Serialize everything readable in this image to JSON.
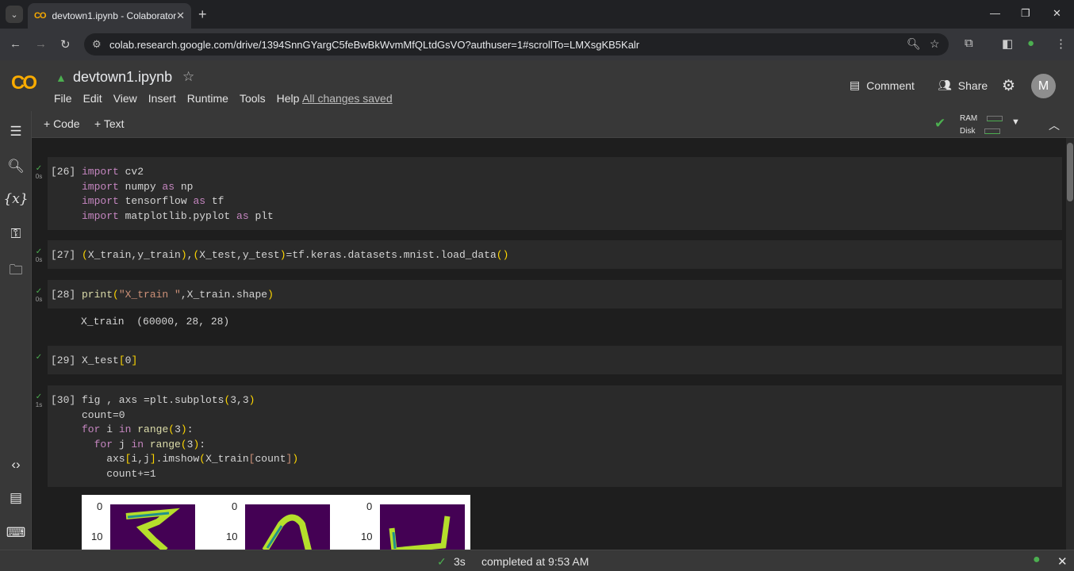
{
  "browser": {
    "tab_title": "devtown1.ipynb - Colaboratory",
    "tab_favicon": "CO",
    "url": "colab.research.google.com/drive/1394SnnGYargC5feBwBkWvmMfQLtdGsVO?authuser=1#scrollTo=LMXsgKB5Kalr",
    "profile_color": "#4caf50"
  },
  "header": {
    "logo": "CO",
    "title": "devtown1.ipynb",
    "menu": [
      "File",
      "Edit",
      "View",
      "Insert",
      "Runtime",
      "Tools",
      "Help"
    ],
    "saved_status": "All changes saved",
    "comment_label": "Comment",
    "share_label": "Share",
    "avatar_letter": "M"
  },
  "toolbar": {
    "code_label": "+ Code",
    "text_label": "+ Text",
    "ram_label": "RAM",
    "disk_label": "Disk"
  },
  "cells": [
    {
      "num": "[26]",
      "time": "0s",
      "code": "import cv2\nimport numpy as np\nimport tensorflow as tf\nimport matplotlib.pyplot as plt"
    },
    {
      "num": "[27]",
      "time": "0s",
      "code": "(X_train,y_train),(X_test,y_test)=tf.keras.datasets.mnist.load_data()"
    },
    {
      "num": "[28]",
      "time": "0s",
      "code": "print(\"X_train \",X_train.shape)",
      "output": "X_train  (60000, 28, 28)"
    },
    {
      "num": "[29]",
      "time": "",
      "code": "X_test[0]"
    },
    {
      "num": "[30]",
      "time": "1s",
      "code": "fig , axs =plt.subplots(3,3)\ncount=0\nfor i in range(3):\n  for j in range(3):\n    axs[i,j].imshow(X_train[count])\n    count+=1"
    }
  ],
  "plot_ticks": [
    "0",
    "10",
    "0",
    "10",
    "0",
    "10"
  ],
  "status": {
    "duration": "3s",
    "message": "completed at 9:53 AM"
  },
  "colors": {
    "accent": "#f9ab00",
    "success": "#4caf50"
  }
}
